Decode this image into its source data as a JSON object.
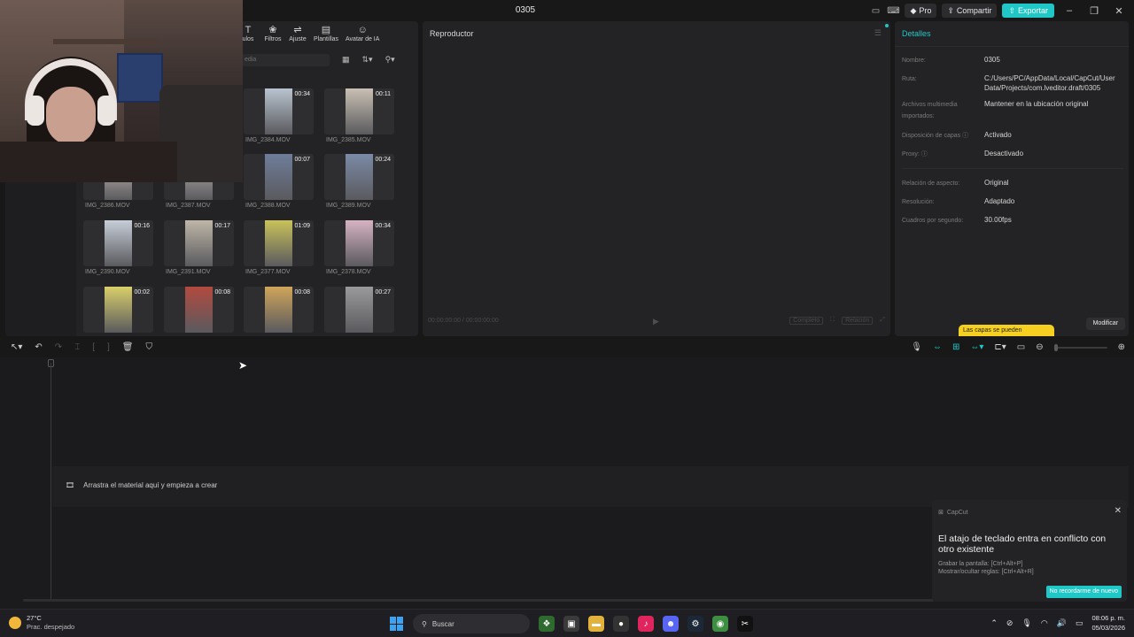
{
  "window": {
    "title": "0305",
    "pro_label": "Pro",
    "share_label": "Compartir",
    "export_label": "Exportar"
  },
  "media": {
    "tabs": [
      {
        "label": "ulos",
        "icon": "text-icon"
      },
      {
        "label": "Filtros",
        "icon": "filter-icon"
      },
      {
        "label": "Ajuste",
        "icon": "adjust-icon"
      },
      {
        "label": "Plantillas",
        "icon": "template-icon"
      },
      {
        "label": "Avatar de IA",
        "icon": "avatar-icon"
      }
    ],
    "search_placeholder": "edia",
    "clips": [
      {
        "name": "IMG_2384.MOV",
        "duration": "00:34",
        "color": "#b9c3cf"
      },
      {
        "name": "IMG_2385.MOV",
        "duration": "00:11",
        "color": "#c9c0b4"
      },
      {
        "name": "IMG_2386.MOV",
        "duration": "",
        "color": "#d7c9c4"
      },
      {
        "name": "IMG_2387.MOV",
        "duration": "",
        "color": "#c7bfb9"
      },
      {
        "name": "IMG_2388.MOV",
        "duration": "00:07",
        "color": "#6f7d9a"
      },
      {
        "name": "IMG_2389.MOV",
        "duration": "00:24",
        "color": "#7b8aa6"
      },
      {
        "name": "IMG_2390.MOV",
        "duration": "00:16",
        "color": "#c7ced8"
      },
      {
        "name": "IMG_2391.MOV",
        "duration": "00:17",
        "color": "#bfb6a8"
      },
      {
        "name": "IMG_2377.MOV",
        "duration": "01:09",
        "color": "#c9c25a"
      },
      {
        "name": "IMG_2378.MOV",
        "duration": "00:34",
        "color": "#d6b3c2"
      },
      {
        "name": "",
        "duration": "00:02",
        "color": "#d9cf6a"
      },
      {
        "name": "",
        "duration": "00:08",
        "color": "#b24a3f"
      },
      {
        "name": "",
        "duration": "00:08",
        "color": "#cfa55a"
      },
      {
        "name": "",
        "duration": "00:27",
        "color": "#9a9a9c"
      }
    ]
  },
  "player": {
    "title": "Reproductor",
    "ctrl_left": "00:00:00:00 / 00:00:00:00",
    "ctrl_full": "Completo",
    "ctrl_ratio": "Relación"
  },
  "details": {
    "title": "Detalles",
    "rows": [
      {
        "label": "Nombre:",
        "value": "0305"
      },
      {
        "label": "Ruta:",
        "value": "C:/Users/PC/AppData/Local/CapCut/User Data/Projects/com.lveditor.draft/0305"
      },
      {
        "label": "Archivos multimedia importados:",
        "value": "Mantener en la ubicación original"
      },
      {
        "label": "Disposición de capas",
        "value": "Activado"
      },
      {
        "label": "Proxy:",
        "value": "Desactivado"
      },
      {
        "label": "Relación de aspecto:",
        "value": "Original"
      },
      {
        "label": "Resolución:",
        "value": "Adaptado"
      },
      {
        "label": "Cuadros por segundo:",
        "value": "30.00fps"
      }
    ],
    "tooltip": "Las capas se pueden",
    "modify_label": "Modificar"
  },
  "timeline": {
    "hint": "Arrastra el material aquí y empieza a crear"
  },
  "notification": {
    "app": "CapCut",
    "title": "El atajo de teclado entra en conflicto con otro existente",
    "line1": "Grabar la pantalla: [Ctrl+Alt+P]",
    "line2": "Mostrar/ocultar reglas: [Ctrl+Alt+R]",
    "button": "No recordarme de nuevo"
  },
  "taskbar": {
    "temp": "27°C",
    "weather": "Prac. despejado",
    "search": "Buscar",
    "time": "08:06 p. m.",
    "date": "05/03/2026"
  },
  "colors": {
    "accent": "#20c7c7",
    "panel": "#232325",
    "background": "#181818",
    "tooltip": "#f5d020"
  }
}
